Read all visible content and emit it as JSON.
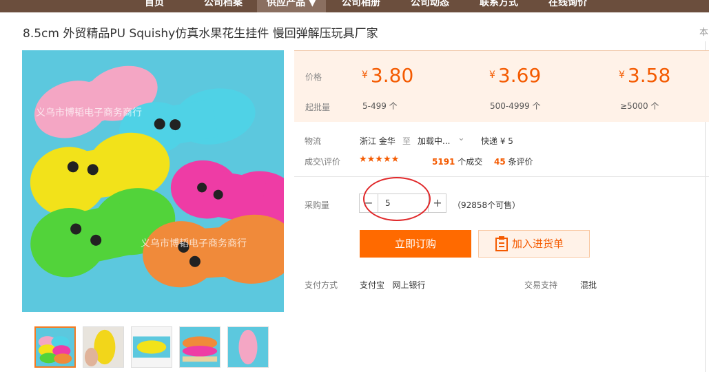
{
  "nav": {
    "items": [
      "首页",
      "公司档案",
      "供应产品 ▼",
      "公司相册",
      "公司动态",
      "联系方式",
      "在线询价"
    ]
  },
  "product": {
    "title": "8.5cm 外贸精品PU Squishy仿真水果花生挂件 慢回弹解压玩具厂家",
    "right_edge_text": "本"
  },
  "image": {
    "watermark": "义乌市博韬电子商务商行"
  },
  "pricing": {
    "price_label": "价格",
    "moq_label": "起批量",
    "currency": "¥",
    "tiers": [
      {
        "price": "3.80",
        "range": "5-499 个"
      },
      {
        "price": "3.69",
        "range": "500-4999 个"
      },
      {
        "price": "3.58",
        "range": "≥5000 个"
      }
    ]
  },
  "logistics": {
    "label": "物流",
    "from": "浙江 金华",
    "to_word": "至",
    "dest": "加载中...",
    "express": "快递 ¥ 5"
  },
  "deals": {
    "label": "成交\\评价",
    "rating": 4.5,
    "stars": "★★★★★",
    "count": "5191",
    "count_unit": "个成交",
    "reviews": "45",
    "reviews_unit": "条评价"
  },
  "purchase": {
    "label": "采购量",
    "minus": "−",
    "plus": "+",
    "quantity": "5",
    "available": "（92858个可售）"
  },
  "buttons": {
    "buy": "立即订购",
    "cart": "加入进货单"
  },
  "payment": {
    "label": "支付方式",
    "methods": "支付宝   网上银行",
    "support_label": "交易支持",
    "support_value": "混批"
  },
  "colors": {
    "accent": "#ff6a00",
    "price": "#f45a00",
    "nav_bg": "#6b4e3d",
    "highlight_circle": "#e0282a"
  }
}
